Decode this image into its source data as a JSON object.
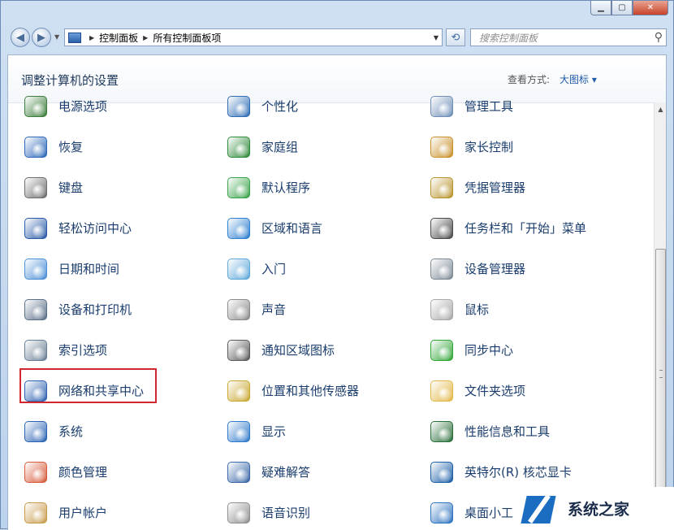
{
  "address": {
    "crumbs": [
      "控制面板",
      "所有控制面板项"
    ]
  },
  "search": {
    "placeholder": "搜索控制面板"
  },
  "header": {
    "title": "调整计算机的设置",
    "view_by_label": "查看方式:",
    "view_by_value": "大图标 ▾"
  },
  "items": [
    {
      "name": "power-options",
      "label": "电源选项",
      "icon": "battery-icon",
      "color": "#3b7d3b"
    },
    {
      "name": "personalization",
      "label": "个性化",
      "icon": "monitor-icon",
      "color": "#2f6db5"
    },
    {
      "name": "admin-tools",
      "label": "管理工具",
      "icon": "checklist-icon",
      "color": "#6f8fb8"
    },
    {
      "name": "recovery",
      "label": "恢复",
      "icon": "pc-restore-icon",
      "color": "#2d67b8"
    },
    {
      "name": "homegroup",
      "label": "家庭组",
      "icon": "homegroup-icon",
      "color": "#2f8a3a"
    },
    {
      "name": "parental-controls",
      "label": "家长控制",
      "icon": "family-icon",
      "color": "#c8902a"
    },
    {
      "name": "keyboard",
      "label": "键盘",
      "icon": "keyboard-icon",
      "color": "#6e6e6e"
    },
    {
      "name": "default-programs",
      "label": "默认程序",
      "icon": "windows-logo-icon",
      "color": "#3aa34a"
    },
    {
      "name": "credential-manager",
      "label": "凭据管理器",
      "icon": "vault-icon",
      "color": "#b9942e"
    },
    {
      "name": "ease-of-access",
      "label": "轻松访问中心",
      "icon": "accessibility-icon",
      "color": "#2a5aa8"
    },
    {
      "name": "region-language",
      "label": "区域和语言",
      "icon": "globe-clock-icon",
      "color": "#2d7fcf"
    },
    {
      "name": "taskbar-start",
      "label": "任务栏和「开始」菜单",
      "icon": "taskbar-icon",
      "color": "#4a4a4a"
    },
    {
      "name": "date-time",
      "label": "日期和时间",
      "icon": "calendar-clock-icon",
      "color": "#4b8fd6"
    },
    {
      "name": "getting-started",
      "label": "入门",
      "icon": "document-icon",
      "color": "#5fa8d8"
    },
    {
      "name": "device-manager",
      "label": "设备管理器",
      "icon": "device-manager-icon",
      "color": "#7d8a96"
    },
    {
      "name": "devices-printers",
      "label": "设备和打印机",
      "icon": "printer-icon",
      "color": "#5a6f88"
    },
    {
      "name": "sound",
      "label": "声音",
      "icon": "speaker-icon",
      "color": "#8a8a8a"
    },
    {
      "name": "mouse",
      "label": "鼠标",
      "icon": "mouse-icon",
      "color": "#a8a8a8"
    },
    {
      "name": "indexing-options",
      "label": "索引选项",
      "icon": "magnifier-icon",
      "color": "#6a7f95"
    },
    {
      "name": "notification-icons",
      "label": "通知区域图标",
      "icon": "tray-icon",
      "color": "#5a5a5a"
    },
    {
      "name": "sync-center",
      "label": "同步中心",
      "icon": "sync-icon",
      "color": "#33a63a"
    },
    {
      "name": "network-sharing",
      "label": "网络和共享中心",
      "icon": "network-icon",
      "color": "#2f62b0"
    },
    {
      "name": "location-sensors",
      "label": "位置和其他传感器",
      "icon": "location-sensor-icon",
      "color": "#c9a730"
    },
    {
      "name": "folder-options",
      "label": "文件夹选项",
      "icon": "folder-icon",
      "color": "#e2b84a"
    },
    {
      "name": "system",
      "label": "系统",
      "icon": "system-icon",
      "color": "#2b63b4"
    },
    {
      "name": "display",
      "label": "显示",
      "icon": "display-icon",
      "color": "#2f7acb"
    },
    {
      "name": "performance-info",
      "label": "性能信息和工具",
      "icon": "performance-icon",
      "color": "#2b6f3b"
    },
    {
      "name": "color-management",
      "label": "颜色管理",
      "icon": "color-icon",
      "color": "#d75a3a"
    },
    {
      "name": "troubleshooting",
      "label": "疑难解答",
      "icon": "troubleshoot-icon",
      "color": "#3b68a8"
    },
    {
      "name": "intel-graphics",
      "label": "英特尔(R) 核芯显卡",
      "icon": "intel-icon",
      "color": "#1c5fa6"
    },
    {
      "name": "user-accounts",
      "label": "用户帐户",
      "icon": "users-icon",
      "color": "#c79b4a"
    },
    {
      "name": "speech-recognition",
      "label": "语音识别",
      "icon": "microphone-icon",
      "color": "#8f8f8f"
    },
    {
      "name": "desktop-gadgets",
      "label": "桌面小工",
      "icon": "gadgets-icon",
      "color": "#2f73c0"
    }
  ],
  "watermark": {
    "text": "系统之家"
  }
}
